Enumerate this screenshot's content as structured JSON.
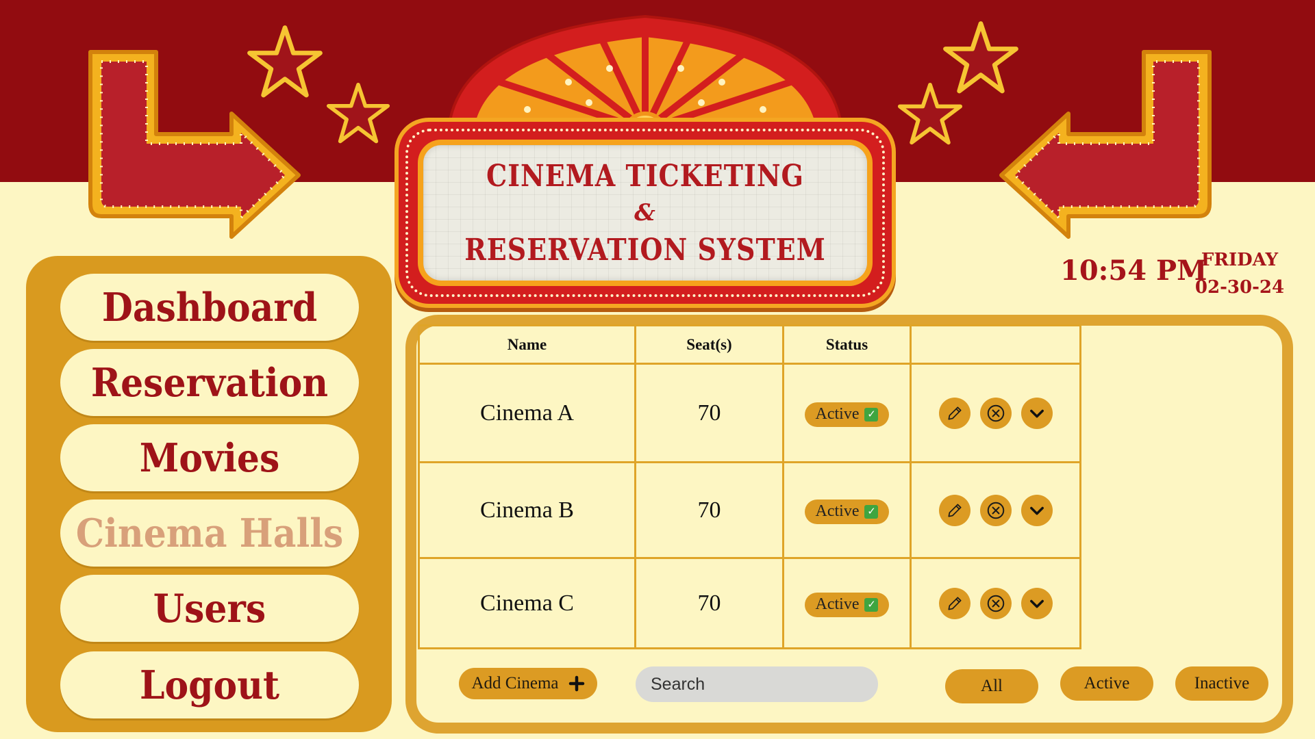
{
  "header": {
    "title_line1": "CINEMA TICKETING",
    "title_amp": "&",
    "title_line2": "RESERVATION SYSTEM",
    "time": "10:54 PM",
    "day": "FRIDAY",
    "date": "02-30-24"
  },
  "sidebar": {
    "items": [
      {
        "label": "Dashboard"
      },
      {
        "label": "Reservation"
      },
      {
        "label": "Movies"
      },
      {
        "label": "Cinema Halls"
      },
      {
        "label": "Users"
      },
      {
        "label": "Logout"
      }
    ],
    "active_index": 3
  },
  "table": {
    "headers": {
      "name": "Name",
      "seats": "Seat(s)",
      "status": "Status",
      "actions": ""
    },
    "rows": [
      {
        "name": "Cinema A",
        "seats": "70",
        "status": "Active"
      },
      {
        "name": "Cinema B",
        "seats": "70",
        "status": "Active"
      },
      {
        "name": "Cinema C",
        "seats": "70",
        "status": "Active"
      }
    ]
  },
  "toolbar": {
    "add_label": "Add Cinema",
    "search_placeholder": "Search",
    "filters": {
      "all": "All",
      "active": "Active",
      "inactive": "Inactive"
    }
  },
  "icons": {
    "add": "plus-icon",
    "search": "search-icon",
    "edit": "pencil-icon",
    "delete": "close-circle-icon",
    "expand": "chevron-down-icon",
    "status_check": "check-box-icon"
  },
  "colors": {
    "top_band": "#920c10",
    "background": "#fdf6c3",
    "accent_gold": "#dc9b23",
    "title_red": "#a5141a",
    "active_nav": "#d8a07a"
  }
}
